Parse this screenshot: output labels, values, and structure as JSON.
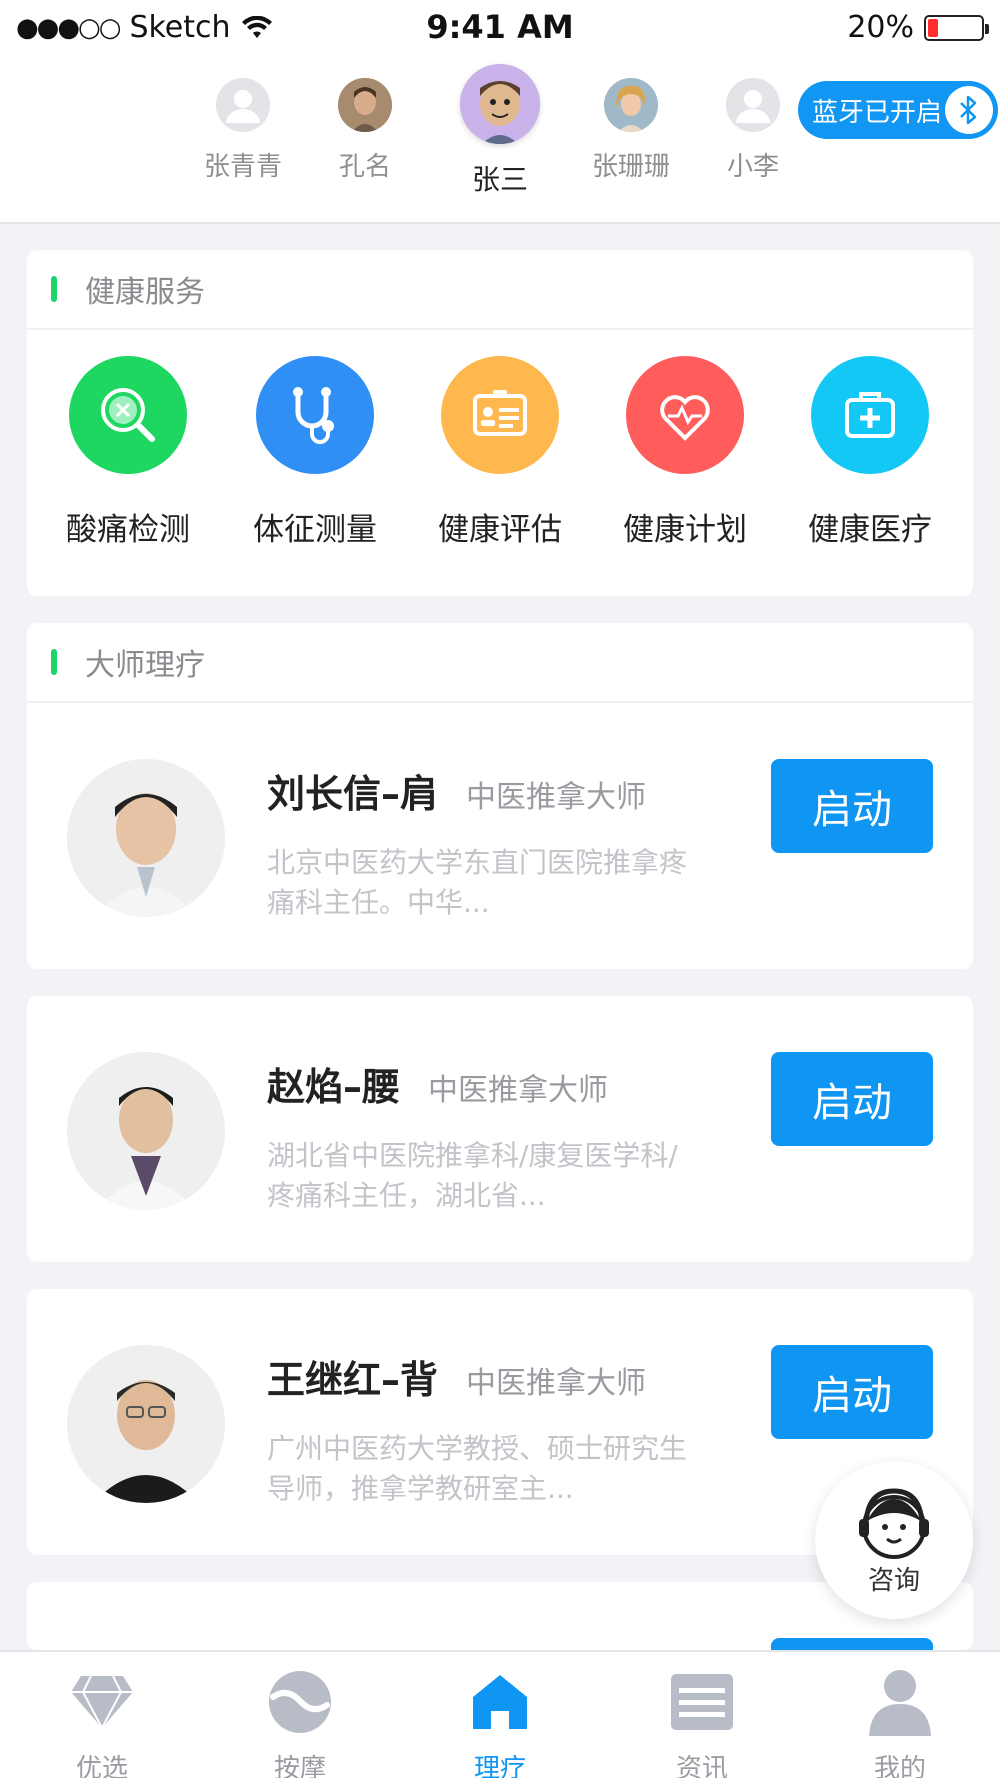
{
  "status_bar": {
    "carrier": "Sketch",
    "signal": "●●●○○",
    "time": "9:41 AM",
    "battery_text": "20%",
    "battery_level": 0.2
  },
  "users": [
    {
      "name": "张青青",
      "avatar": "default-avatar"
    },
    {
      "name": "孔名",
      "avatar": "photo-avatar"
    },
    {
      "name": "张三",
      "avatar": "cartoon-avatar",
      "active": true
    },
    {
      "name": "张珊珊",
      "avatar": "photo-avatar"
    },
    {
      "name": "小李",
      "avatar": "default-avatar"
    }
  ],
  "bluetooth": {
    "label": "蓝牙已开启",
    "icon": "bluetooth-icon"
  },
  "health_services": {
    "title": "健康服务",
    "items": [
      {
        "label": "酸痛检测",
        "icon": "magnifier-icon",
        "color": "#1ed761"
      },
      {
        "label": "体征测量",
        "icon": "stethoscope-icon",
        "color": "#2f8ff5"
      },
      {
        "label": "健康评估",
        "icon": "id-card-icon",
        "color": "#ffb84d"
      },
      {
        "label": "健康计划",
        "icon": "heart-pulse-icon",
        "color": "#ff5c5c"
      },
      {
        "label": "健康医疗",
        "icon": "medical-kit-icon",
        "color": "#14c8f5"
      }
    ]
  },
  "master_therapy": {
    "title": "大师理疗",
    "doctors": [
      {
        "name": "刘长信–肩",
        "title": "中医推拿大师",
        "desc": "北京中医药大学东直门医院推拿疼痛科主任。中华...",
        "button": "启动"
      },
      {
        "name": "赵焰–腰",
        "title": "中医推拿大师",
        "desc": "湖北省中医院推拿科/康复医学科/疼痛科主任，湖北省...",
        "button": "启动"
      },
      {
        "name": "王继红–背",
        "title": "中医推拿大师",
        "desc": "广州中医药大学教授、硕士研究生导师，推拿学教研室主...",
        "button": "启动"
      }
    ]
  },
  "consult": {
    "label": "咨询",
    "icon": "customer-service-icon"
  },
  "tabs": [
    {
      "label": "优选",
      "icon": "diamond-icon"
    },
    {
      "label": "按摩",
      "icon": "massage-icon"
    },
    {
      "label": "理疗",
      "icon": "home-icon",
      "active": true
    },
    {
      "label": "资讯",
      "icon": "news-icon"
    },
    {
      "label": "我的",
      "icon": "profile-icon"
    }
  ],
  "colors": {
    "accent": "#0f96f3",
    "section_bar": "#1cd46c",
    "battery_low": "#ff2d2d"
  }
}
